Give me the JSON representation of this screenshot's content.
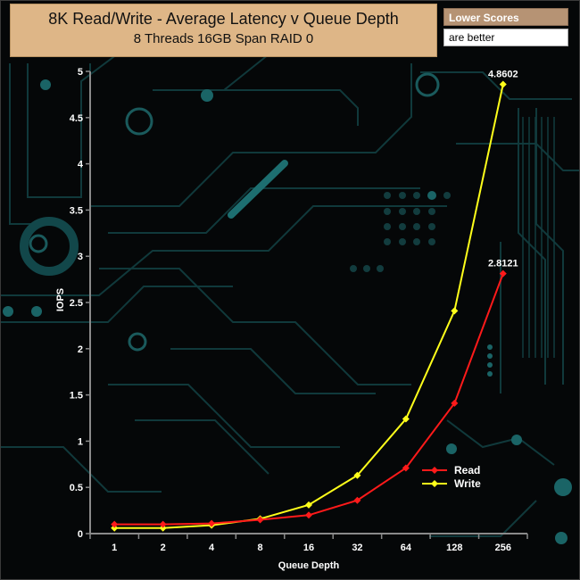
{
  "header": {
    "title": "8K Read/Write - Average Latency v Queue Depth",
    "subtitle": "8 Threads 16GB Span RAID 0"
  },
  "note": {
    "heading": "Lower Scores",
    "text": "are better"
  },
  "chart_data": {
    "type": "line",
    "xlabel": "Queue Depth",
    "ylabel": "IOPS",
    "categories": [
      "1",
      "2",
      "4",
      "8",
      "16",
      "32",
      "64",
      "128",
      "256"
    ],
    "ylim": [
      0,
      5
    ],
    "yticks": [
      "0",
      "0.5",
      "1",
      "1.5",
      "2",
      "2.5",
      "3",
      "3.5",
      "4",
      "4.5",
      "5"
    ],
    "grid": false,
    "legend_position": "bottom-right",
    "series": [
      {
        "name": "Read",
        "color": "#ff1a1a",
        "values": [
          0.1,
          0.1,
          0.11,
          0.15,
          0.2,
          0.36,
          0.71,
          1.41,
          2.8121
        ],
        "end_label": "2.8121"
      },
      {
        "name": "Write",
        "color": "#ffff1a",
        "values": [
          0.06,
          0.06,
          0.09,
          0.16,
          0.31,
          0.63,
          1.24,
          2.41,
          4.8602
        ],
        "end_label": "4.8602"
      }
    ]
  }
}
